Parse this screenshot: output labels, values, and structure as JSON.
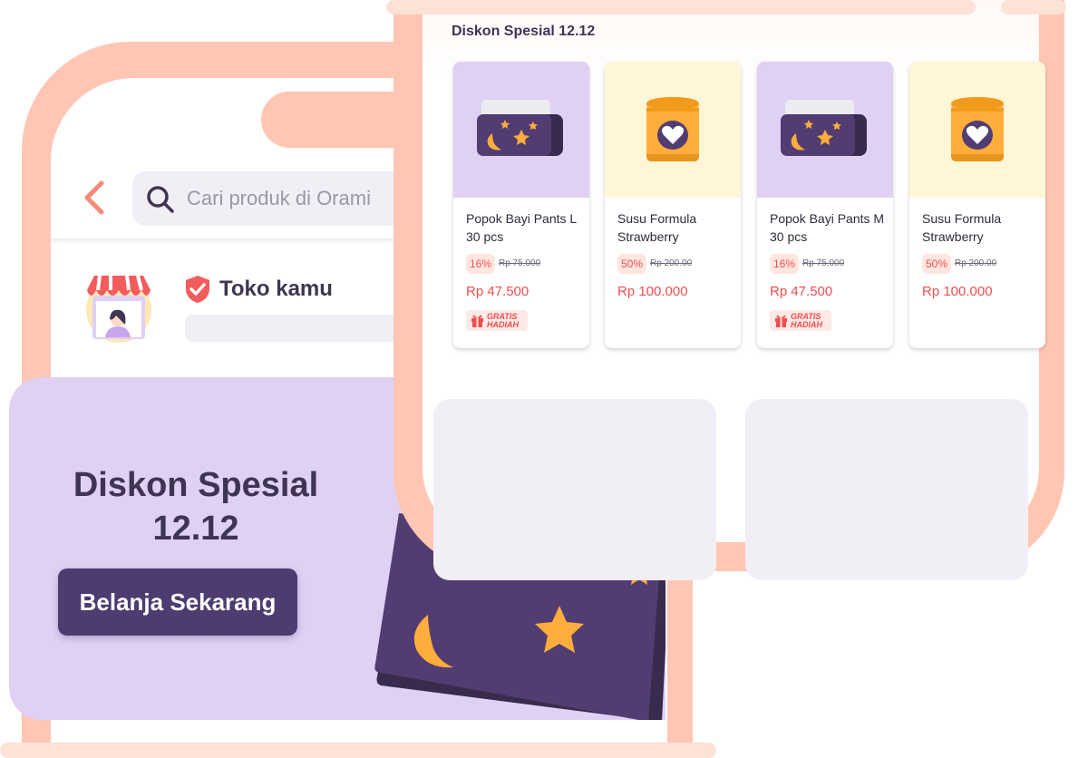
{
  "search": {
    "placeholder": "Cari produk di Orami"
  },
  "store": {
    "title": "Toko kamu"
  },
  "banner": {
    "title_line1": "Diskon Spesial",
    "title_line2": "12.12",
    "button_label": "Belanja Sekarang"
  },
  "section": {
    "title": "Diskon Spesial 12.12"
  },
  "products": [
    {
      "name": "Popok Bayi Pants L 30 pcs",
      "discount": "16%",
      "original_price": "Rp 75.000",
      "price": "Rp 47.500",
      "gift_line1": "GRATIS",
      "gift_line2": "HADIAH",
      "image_icon": "diaper-pack-icon"
    },
    {
      "name": "Susu Formula Strawberry",
      "discount": "50%",
      "original_price": "Rp 200.00",
      "price": "Rp 100.000",
      "image_icon": "formula-can-icon"
    },
    {
      "name": "Popok Bayi Pants M 30 pcs",
      "discount": "16%",
      "original_price": "Rp 75.000",
      "price": "Rp 47.500",
      "gift_line1": "GRATIS",
      "gift_line2": "HADIAH",
      "image_icon": "diaper-pack-icon"
    },
    {
      "name": "Susu Formula Strawberry",
      "discount": "50%",
      "original_price": "Rp 200.00",
      "price": "Rp 100.000",
      "image_icon": "formula-can-icon"
    }
  ],
  "colors": {
    "frame": "#ffc6b3",
    "brand_purple": "#4e3b6f",
    "banner_bg": "#e0d0f4",
    "price_red": "#f04d4d",
    "accent_orange": "#ffad3b"
  }
}
